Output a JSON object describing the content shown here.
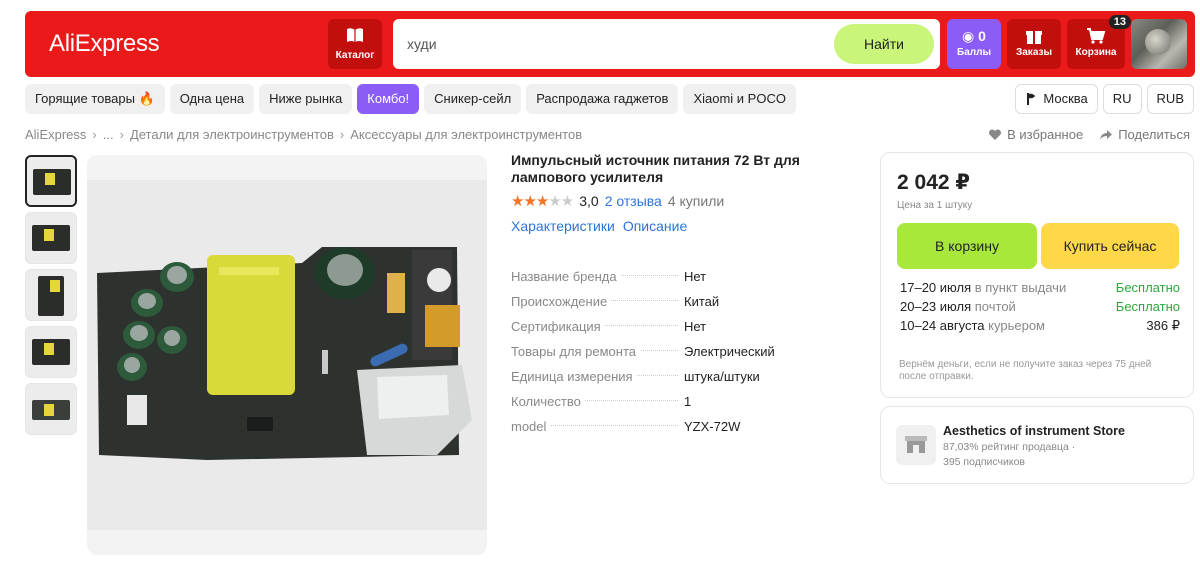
{
  "header": {
    "logo": "AliExpress",
    "catalog_label": "Каталог",
    "search_value": "худи",
    "search_button": "Найти",
    "points_count": "0",
    "points_label": "Баллы",
    "orders_label": "Заказы",
    "cart_label": "Корзина",
    "cart_badge": "13"
  },
  "nav": {
    "chips": [
      "Горящие товары 🔥",
      "Одна цена",
      "Ниже рынка",
      "Комбо!",
      "Сникер-сейл",
      "Распродажа гаджетов",
      "Xiaomi и POCO"
    ],
    "active_chip": "Комбо!",
    "location": "Москва",
    "language": "RU",
    "currency": "RUB"
  },
  "breadcrumb": {
    "items": [
      "AliExpress",
      "...",
      "Детали для электроинструментов",
      "Аксессуары для электроинструментов"
    ],
    "favorite": "В избранное",
    "share": "Поделиться"
  },
  "product": {
    "title": "Импульсный источник питания 72 Вт для лампового усилителя",
    "rating_value": "3,0",
    "stars_filled": 3,
    "stars_total": 5,
    "reviews": "2 отзыва",
    "purchases": "4 купили",
    "tab_specs": "Характеристики",
    "tab_description": "Описание",
    "specs": [
      {
        "key": "Название бренда",
        "value": "Нет"
      },
      {
        "key": "Происхождение",
        "value": "Китай"
      },
      {
        "key": "Сертификация",
        "value": "Нет"
      },
      {
        "key": "Товары для ремонта",
        "value": "Электрический"
      },
      {
        "key": "Единица измерения",
        "value": "штука/штуки"
      },
      {
        "key": "Количество",
        "value": "1"
      },
      {
        "key": "model",
        "value": "YZX-72W"
      }
    ]
  },
  "buy": {
    "price": "2 042 ₽",
    "price_note": "Цена за 1 штуку",
    "add_to_cart": "В корзину",
    "buy_now": "Купить сейчас",
    "delivery": [
      {
        "date": "17–20 июля",
        "method": "в пункт выдачи",
        "cost": "Бесплатно",
        "free": true
      },
      {
        "date": "20–23 июля",
        "method": "почтой",
        "cost": "Бесплатно",
        "free": true
      },
      {
        "date": "10–24 августа",
        "method": "курьером",
        "cost": "386 ₽",
        "free": false
      }
    ],
    "refund_note": "Вернём деньги, если не получите заказ через 75 дней после отправки."
  },
  "seller": {
    "name": "Aesthetics of instrument Store",
    "rating": "87,03% рейтинг продавца  ·",
    "subscribers": "395 подписчиков"
  },
  "colors": {
    "brand_red": "#ea1a1a",
    "accent_purple": "#8b5cf6",
    "cart_green": "#a8e83d",
    "buy_yellow": "#ffd84a",
    "link_blue": "#2d74d8",
    "free_green": "#2aa83a"
  }
}
